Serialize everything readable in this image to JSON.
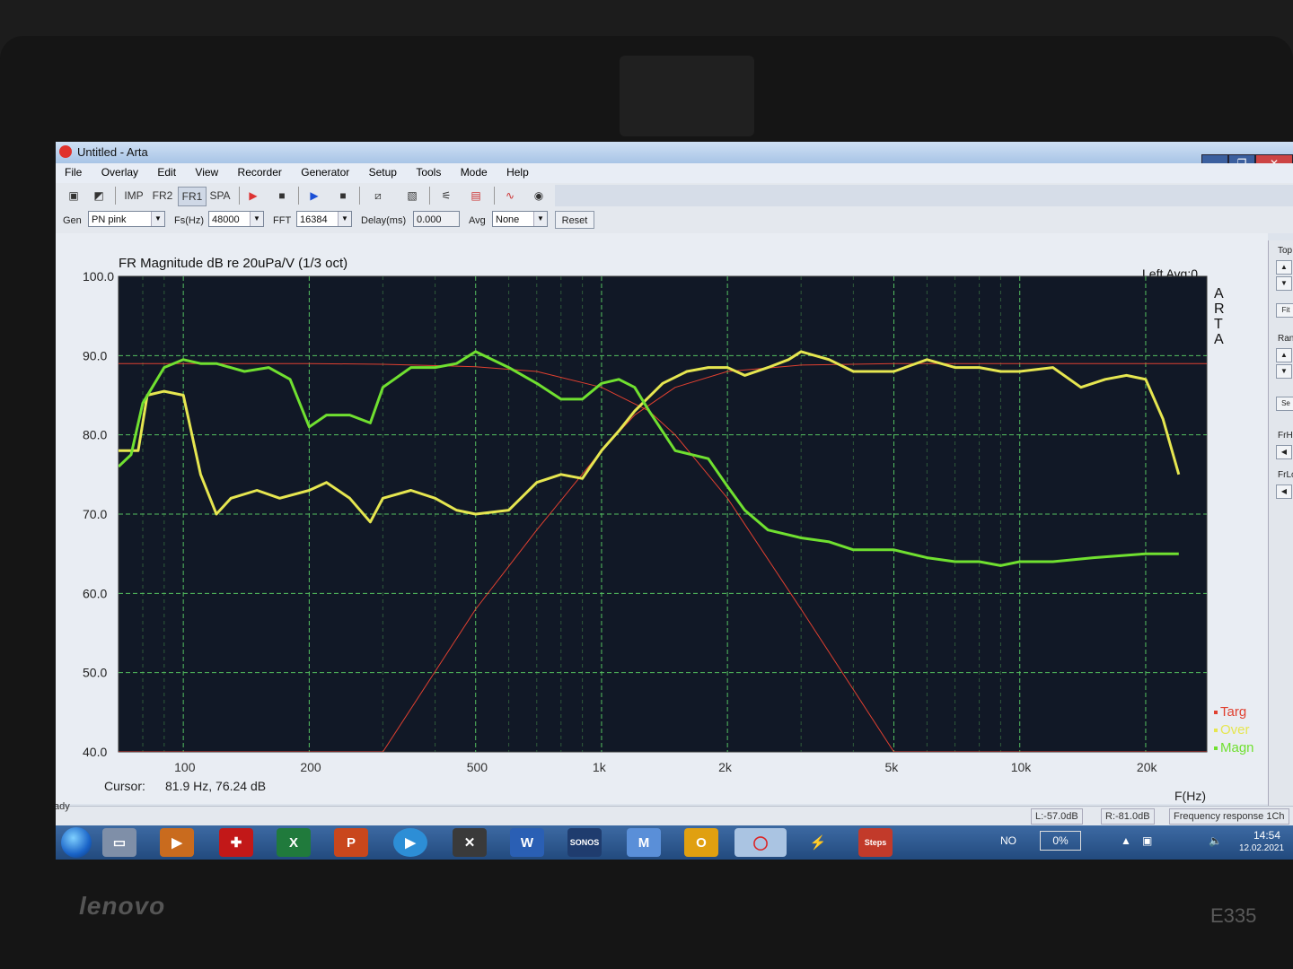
{
  "window": {
    "title": "Untitled - Arta"
  },
  "menu": [
    "File",
    "Overlay",
    "Edit",
    "View",
    "Recorder",
    "Generator",
    "Setup",
    "Tools",
    "Mode",
    "Help"
  ],
  "toolbar": {
    "imp": "IMP",
    "frz": "FR2",
    "fr1": "FR1",
    "spa": "SPA"
  },
  "params": {
    "gen_label": "Gen",
    "gen_value": "PN pink",
    "fs_label": "Fs(Hz)",
    "fs_value": "48000",
    "fft_label": "FFT",
    "fft_value": "16384",
    "delay_label": "Delay(ms)",
    "delay_value": "0.000",
    "avg_label": "Avg",
    "avg_value": "None",
    "reset_label": "Reset"
  },
  "plot": {
    "title": "FR Magnitude dB re 20uPa/V (1/3 oct)",
    "channel": "Left  Avg:0",
    "brand": "ARTA",
    "xlabel": "F(Hz)",
    "cursor_label": "Cursor:",
    "cursor_value": "81.9 Hz, 76.24 dB"
  },
  "right_panel": {
    "top": "Top",
    "fit": "Fit",
    "range": "Rang",
    "set": "Se",
    "frhi": "FrHi",
    "frlo": "FrLo"
  },
  "status": {
    "ready": "Ready",
    "left_level": "L:-57.0dB",
    "right_level": "R:-81.0dB",
    "mode": "Frequency response 1Ch"
  },
  "taskbar": {
    "lang": "NO",
    "battery": "0%",
    "time": "14:54",
    "date": "12.02.2021",
    "apps": [
      "Explorer",
      "Media",
      "Antivirus",
      "Excel",
      "PowerPoint",
      "Media Player",
      "CrossX",
      "Word",
      "SONOS",
      "Maps",
      "Outlook",
      "ARTA",
      "Power",
      "Steps"
    ]
  },
  "laptop": {
    "brand": "lenovo",
    "model": "E335"
  },
  "chart_data": {
    "type": "line",
    "title": "FR Magnitude dB re 20uPa/V (1/3 oct)",
    "xlabel": "F(Hz)",
    "ylabel": "",
    "xscale": "log",
    "xlim": [
      70,
      28000
    ],
    "ylim": [
      40,
      100
    ],
    "yticks": [
      40,
      50,
      60,
      70,
      80,
      90,
      100
    ],
    "yticklabels": [
      "40.0",
      "50.0",
      "60.0",
      "70.0",
      "80.0",
      "90.0",
      "100.0"
    ],
    "xticks": [
      100,
      200,
      500,
      1000,
      2000,
      5000,
      10000,
      20000
    ],
    "xticklabels": [
      "100",
      "200",
      "500",
      "1k",
      "2k",
      "5k",
      "10k",
      "20k"
    ],
    "grid": true,
    "legend_position": "bottom-right",
    "series": [
      {
        "name": "Targ",
        "color": "#e04030",
        "x": [
          70,
          200,
          300,
          500,
          700,
          1000,
          1300,
          1500,
          2000,
          3000,
          5000,
          10000,
          20000,
          28000
        ],
        "y": [
          89,
          89,
          88.9,
          88.6,
          88,
          86,
          83,
          80,
          72,
          58,
          40,
          40,
          40,
          40
        ]
      },
      {
        "name": "Targ",
        "color": "#e04030",
        "x": [
          70,
          300,
          500,
          700,
          1000,
          1200,
          1500,
          2000,
          3000,
          5000,
          10000,
          28000
        ],
        "y": [
          40,
          40,
          58,
          68,
          78,
          82.5,
          86,
          88,
          88.8,
          89,
          89,
          89
        ]
      },
      {
        "name": "Over",
        "color": "#e6e650",
        "x": [
          70,
          78,
          82,
          90,
          100,
          110,
          120,
          130,
          150,
          170,
          200,
          220,
          250,
          280,
          300,
          350,
          400,
          450,
          500,
          600,
          700,
          800,
          900,
          1000,
          1100,
          1200,
          1400,
          1600,
          1800,
          2000,
          2200,
          2500,
          2800,
          3000,
          3500,
          4000,
          4500,
          5000,
          6000,
          7000,
          8000,
          9000,
          10000,
          12000,
          14000,
          16000,
          18000,
          20000,
          22000,
          24000
        ],
        "y": [
          78,
          78,
          85,
          85.5,
          85,
          75,
          70,
          72,
          73,
          72,
          73,
          74,
          72,
          69,
          72,
          73,
          72,
          70.5,
          70,
          70.5,
          74,
          75,
          74.5,
          78,
          80.5,
          83,
          86.5,
          88,
          88.5,
          88.5,
          87.5,
          88.5,
          89.5,
          90.5,
          89.5,
          88,
          88,
          88,
          89.5,
          88.5,
          88.5,
          88,
          88,
          88.5,
          86,
          87,
          87.5,
          87,
          82,
          75
        ]
      },
      {
        "name": "Magn",
        "color": "#70e030",
        "x": [
          70,
          75,
          80,
          90,
          100,
          110,
          120,
          140,
          160,
          180,
          200,
          220,
          250,
          280,
          300,
          350,
          400,
          450,
          500,
          600,
          700,
          800,
          900,
          1000,
          1100,
          1200,
          1300,
          1500,
          1800,
          2000,
          2200,
          2500,
          3000,
          3500,
          4000,
          5000,
          6000,
          7000,
          8000,
          9000,
          10000,
          12000,
          15000,
          20000,
          24000
        ],
        "y": [
          76,
          77.5,
          84,
          88.5,
          89.5,
          89,
          89,
          88,
          88.5,
          87,
          81,
          82.5,
          82.5,
          81.5,
          86,
          88.5,
          88.5,
          89,
          90.5,
          88.5,
          86.5,
          84.5,
          84.5,
          86.5,
          87,
          86,
          83,
          78,
          77,
          73.5,
          70.5,
          68,
          67,
          66.5,
          65.5,
          65.5,
          64.5,
          64,
          64,
          63.5,
          64,
          64,
          64.5,
          65,
          65
        ]
      }
    ]
  }
}
